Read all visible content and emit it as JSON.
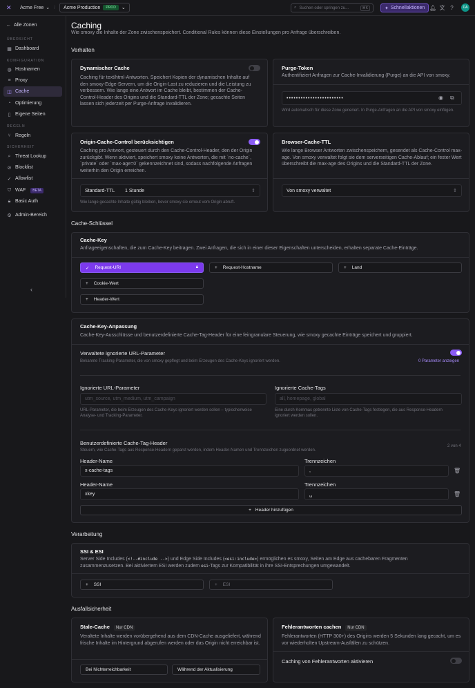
{
  "topbar": {
    "account": "Acme Free",
    "project": "Acme Production",
    "project_badge": "PROD",
    "search_placeholder": "Suchen oder springen zu...",
    "search_shortcut": "⌘K",
    "quick_actions": "Schnellaktionen",
    "avatar": "DA"
  },
  "sidebar": {
    "back": "Alle Zonen",
    "sections": [
      {
        "title": "ÜBERSICHT"
      },
      {
        "title": "KONFIGURATION"
      },
      {
        "title": "REGELN"
      },
      {
        "title": "SICHERHEIT"
      }
    ],
    "items": [
      {
        "label": "Dashboard"
      },
      {
        "label": "Hostnamen"
      },
      {
        "label": "Proxy"
      },
      {
        "label": "Cache"
      },
      {
        "label": "Optimierung"
      },
      {
        "label": "Eigene Seiten"
      },
      {
        "label": "Regeln"
      },
      {
        "label": "Threat Lookup"
      },
      {
        "label": "Blocklist"
      },
      {
        "label": "Allowlist"
      },
      {
        "label": "WAF",
        "badge": "BETA"
      },
      {
        "label": "Basic Auth"
      },
      {
        "label": "Admin-Bereich"
      }
    ]
  },
  "page": {
    "title": "Caching",
    "subtitle": "Wie smoxy die Inhalte der Zone zwischenspeichert. Conditional Rules können diese Einstellungen pro Anfrage überschreiben."
  },
  "sections": {
    "behavior": "Verhalten",
    "cache_keys": "Cache-Schlüssel",
    "processing": "Verarbeitung",
    "resilience": "Ausfallsicherheit"
  },
  "dynamic_cache": {
    "title": "Dynamischer Cache",
    "text": "Caching für text/html-Antworten. Speichert Kopien der dynamischen Inhalte auf den smoxy-Edge-Servern, um die Origin-Last zu reduzieren und die Leistung zu verbessern. Wie lange eine Antwort im Cache bleibt, bestimmen der Cache-Control-Header des Origins und die Standard-TTL der Zone; gecachte Seiten lassen sich jederzeit per Purge-Anfrage invalidieren.",
    "enabled": false
  },
  "purge_token": {
    "title": "Purge-Token",
    "text": "Authentifiziert Anfragen zur Cache-Invalidierung (Purge) an die API von smoxy.",
    "value": "••••••••••••••••••••••••",
    "hint": "Wird automatisch für diese Zone generiert. In Purge-Anfragen an die API von smoxy einfügen."
  },
  "origin_cc": {
    "title": "Origin-Cache-Control berücksichtigen",
    "text": "Caching pro Antwort, gesteuert durch den Cache-Control-Header, den der Origin zurückgibt. Wenn aktiviert, speichert smoxy keine Antworten, die mit `no-cache`, `private` oder `max-age=0` gekennzeichnet sind, sodass nachfolgende Anfragen weiterhin den Origin erreichen.",
    "enabled": true,
    "ttl_label": "Standard-TTL",
    "ttl_value": "1 Stunde",
    "ttl_hint": "Wie lange gecachte Inhalte gültig bleiben, bevor smoxy sie erneut vom Origin abruft."
  },
  "browser_ttl": {
    "title": "Browser-Cache-TTL",
    "text": "Wie lange Browser Antworten zwischenspeichern, gesendet als Cache-Control max-age. Von smoxy verwaltet folgt sie dem serverseitigen Cache-Ablauf; ein fester Wert überschreibt die max-age des Origins und die Standard-TTL der Zone.",
    "value": "Von smoxy verwaltet"
  },
  "cache_key": {
    "title": "Cache-Key",
    "text": "Anfrageeigenschaften, die zum Cache-Key beitragen. Zwei Anfragen, die sich in einer dieser Eigenschaften unterscheiden, erhalten separate Cache-Einträge.",
    "chips": [
      "Request-URI",
      "Request-Hostname",
      "Land",
      "Cookie-Wert",
      "Header-Wert"
    ]
  },
  "key_custom": {
    "title": "Cache-Key-Anpassung",
    "text": "Cache-Key-Ausschlüsse und benutzerdefinierte Cache-Tag-Header für eine feingranulare Steuerung, wie smoxy gecachte Einträge speichert und gruppiert.",
    "managed_title": "Verwaltete ignorierte URL-Parameter",
    "managed_text": "Bekannte Tracking-Parameter, die von smoxy gepflegt und beim Erzeugen des Cache-Keys ignoriert werden.",
    "managed_link": "0 Parameter anzeigen",
    "managed_enabled": true,
    "ignored_params_label": "Ignorierte URL-Parameter",
    "ignored_params_placeholder": "utm_source, utm_medium, utm_campaign",
    "ignored_params_hint": "URL-Parameter, die beim Erzeugen des Cache-Keys ignoriert werden sollen – typischerweise Analyse- und Tracking-Parameter.",
    "ignored_tags_label": "Ignorierte Cache-Tags",
    "ignored_tags_placeholder": "all, homepage, global",
    "ignored_tags_hint": "Eine durch Kommas getrennte Liste von Cache-Tags festlegen, die aus Response-Headern ignoriert werden sollen.",
    "tag_headers_title": "Benutzerdefinierte Cache-Tag-Header",
    "tag_headers_text": "Steuern, wie Cache-Tags aus Response-Headern geparst werden, indem Header-Namen und Trennzeichen zugeordnet werden.",
    "tag_headers_count": "2 von 4",
    "header_name_label": "Header-Name",
    "separator_label": "Trennzeichen",
    "headers": [
      {
        "name": "x-cache-tags",
        "separator": ","
      },
      {
        "name": "xkey",
        "separator": "␣"
      }
    ],
    "add_header": "Header hinzufügen"
  },
  "ssi_esi": {
    "title": "SSI & ESI",
    "text_a": "Server Side Includes (",
    "code_a": "&lt;!--#include --&gt;",
    "text_b": ") und Edge Side Includes (",
    "code_b": "&lt;esi:include&gt;",
    "text_c": ") ermöglichen es smoxy, Seiten am Edge aus cachebaren Fragmenten zusammenzusetzen. Bei aktiviertem ESI werden zudem ",
    "code_c": "esi",
    "text_d": "-Tags zur Kompatibilität in ihre SSI-Entsprechungen umgewandelt.",
    "chips": [
      "SSI",
      "ESI"
    ]
  },
  "stale_cache": {
    "title": "Stale-Cache",
    "tag": "Nur CDN",
    "text": "Veraltete Inhalte werden vorübergehend aus dem CDN-Cache ausgeliefert, während frische Inhalte im Hintergrund abgerufen werden oder das Origin nicht erreichbar ist.",
    "options": [
      "Bei Nichterreichbarkeit",
      "Während der Aktualisierung"
    ]
  },
  "error_cache": {
    "title": "Fehlerantworten cachen",
    "tag": "Nur CDN",
    "text": "Fehlerantworten (HTTP 300+) des Origins werden 5 Sekunden lang gecacht, um es vor wiederholten Upstream-Ausfällen zu schützen.",
    "toggle_label": "Caching von Fehlerantworten aktivieren",
    "enabled": false
  }
}
